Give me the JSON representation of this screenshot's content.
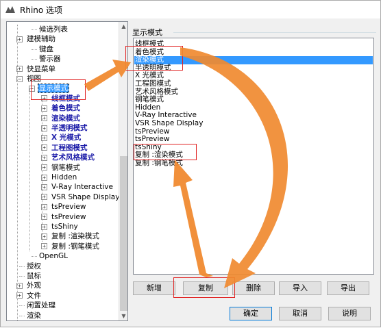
{
  "window": {
    "title": "Rhino 选项",
    "app_icon": "rhino-icon"
  },
  "tree": {
    "items": [
      {
        "label": "候选列表",
        "expander": false
      },
      {
        "label": "建模辅助",
        "expander": "+"
      },
      {
        "label": "键盘",
        "expander": false
      },
      {
        "label": "警示器",
        "expander": false
      },
      {
        "label": "快显菜单",
        "expander": "+"
      },
      {
        "label": "视图",
        "expander": "−"
      },
      {
        "label": "显示模式",
        "expander": "−",
        "selected": true
      },
      {
        "label": "线框模式",
        "expander": "+",
        "bold": true
      },
      {
        "label": "着色模式",
        "expander": "+",
        "bold": true
      },
      {
        "label": "渲染模式",
        "expander": "+",
        "bold": true
      },
      {
        "label": "半透明模式",
        "expander": "+",
        "bold": true
      },
      {
        "label": "X 光模式",
        "expander": "+",
        "bold": true
      },
      {
        "label": "工程图模式",
        "expander": "+",
        "bold": true
      },
      {
        "label": "艺术风格模式",
        "expander": "+",
        "bold": true
      },
      {
        "label": "钢笔模式",
        "expander": "+"
      },
      {
        "label": "Hidden",
        "expander": "+"
      },
      {
        "label": "V-Ray Interactive",
        "expander": "+"
      },
      {
        "label": "VSR Shape Display",
        "expander": "+"
      },
      {
        "label": "tsPreview",
        "expander": "+"
      },
      {
        "label": "tsPreview",
        "expander": "+"
      },
      {
        "label": "tsShiny",
        "expander": "+"
      },
      {
        "label": "复制 :渲染模式",
        "expander": "+"
      },
      {
        "label": "复制 :钢笔模式",
        "expander": "+"
      },
      {
        "label": "OpenGL",
        "expander": false
      },
      {
        "label": "授权",
        "expander": false
      },
      {
        "label": "鼠标",
        "expander": false
      },
      {
        "label": "外观",
        "expander": "+"
      },
      {
        "label": "文件",
        "expander": "+"
      },
      {
        "label": "闲置处理",
        "expander": false
      },
      {
        "label": "渲染",
        "expander": false
      }
    ]
  },
  "panel": {
    "group_label": "显示模式",
    "modes": [
      "线框模式",
      "着色模式",
      "渲染模式",
      "半透明模式",
      "X 光模式",
      "工程图模式",
      "艺术风格模式",
      "钢笔模式",
      "Hidden",
      "V-Ray Interactive",
      "VSR Shape Display",
      "tsPreview",
      "tsPreview",
      "tsShiny",
      "复制 :渲染模式",
      "复制 :钢笔模式"
    ],
    "selected_mode": "渲染模式",
    "buttons": {
      "new": "新增",
      "copy": "复制",
      "delete": "删除",
      "import": "导入",
      "export": "导出"
    }
  },
  "footer": {
    "ok": "确定",
    "cancel": "取消",
    "help": "说明"
  },
  "colors": {
    "selection": "#3399ff",
    "highlight_box": "#e02020",
    "arrow": "#f08a30",
    "tree_bold": "#1a1aa8"
  }
}
